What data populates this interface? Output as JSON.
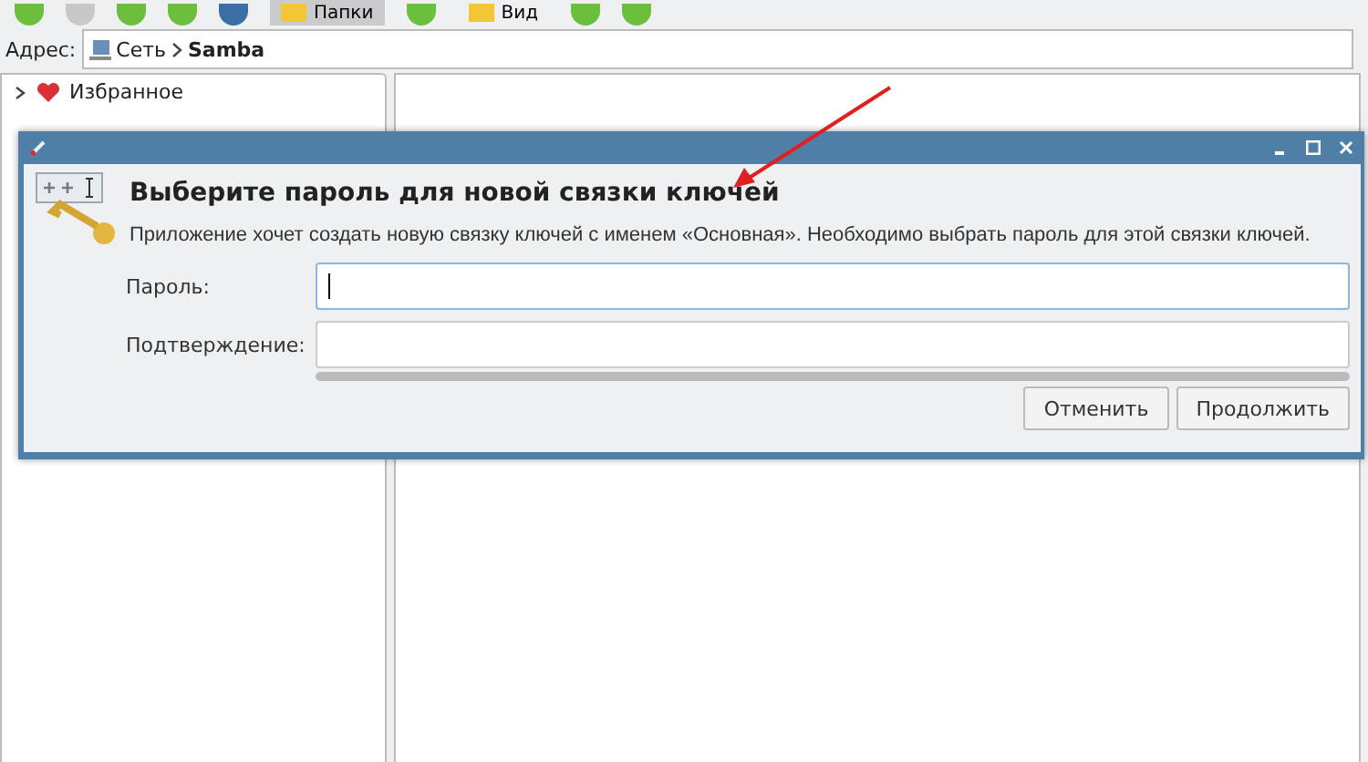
{
  "toolbar": {
    "items": [
      {
        "kind": "icon"
      },
      {
        "kind": "icon"
      },
      {
        "kind": "icon"
      },
      {
        "kind": "icon"
      },
      {
        "kind": "icon"
      },
      {
        "kind": "button",
        "label": "Папки",
        "selected": true
      },
      {
        "kind": "icon"
      },
      {
        "kind": "button",
        "label": "Вид",
        "selected": false
      },
      {
        "kind": "icon"
      },
      {
        "kind": "icon"
      }
    ]
  },
  "address": {
    "label": "Адрес:",
    "path": [
      {
        "text": "Сеть",
        "bold": false
      },
      {
        "text": "Samba",
        "bold": true
      }
    ]
  },
  "sidebar": {
    "items": [
      {
        "label": "Избранное",
        "expanded": false
      }
    ]
  },
  "dialog": {
    "title": "Выберите пароль для новой связки ключей",
    "message": "Приложение хочет создать новую связку ключей с именем «Основная». Необходимо выбрать пароль для этой связки ключей.",
    "fields": [
      {
        "label": "Пароль:",
        "focused": true
      },
      {
        "label": "Подтверждение:",
        "focused": false
      }
    ],
    "buttons": [
      "Отменить",
      "Продолжить"
    ]
  }
}
